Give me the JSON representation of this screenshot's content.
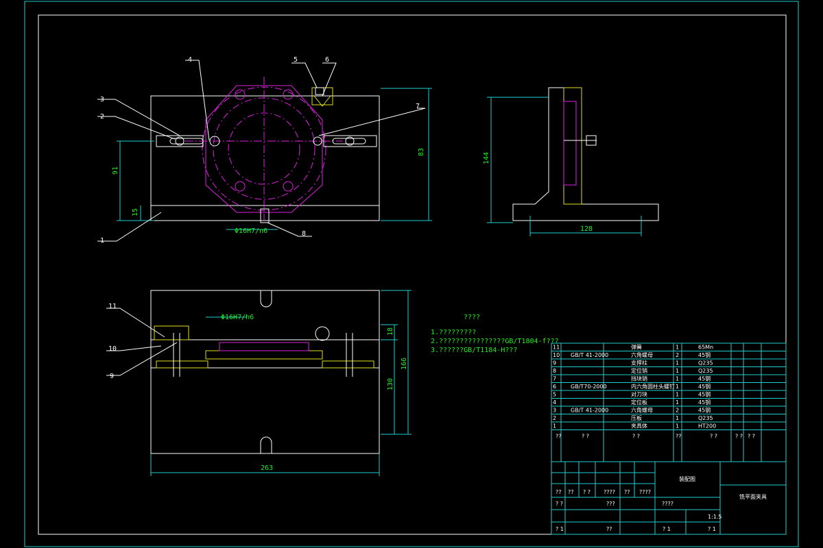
{
  "colors": {
    "background": "#000000",
    "frame": "#20d0d0",
    "outline": "#ffffff",
    "magenta": "#e020e0",
    "dim": "#20d0d0",
    "note": "#20e020",
    "hatch": "#e0e020"
  },
  "balloons": [
    "1",
    "2",
    "3",
    "4",
    "5",
    "6",
    "7",
    "8",
    "9",
    "10",
    "11"
  ],
  "dims": {
    "front_height": "83",
    "front_center": "91",
    "front_base": "15",
    "front_bottom": "Φ16H7/n6",
    "side_height": "144",
    "side_width": "128",
    "top_width": "263",
    "top_height": "166",
    "top_inner": "130",
    "top_small": "18",
    "top_fit": "Φ16H7/h6"
  },
  "notes": {
    "title": "????",
    "lines": [
      "1.?????????",
      "2.????????????????GB/T1804-f???",
      "3.??????GB/T1184-H???"
    ]
  },
  "bom": [
    {
      "no": "11",
      "std": "",
      "name": "弹簧",
      "qty": "1",
      "mat": "65Mn"
    },
    {
      "no": "10",
      "std": "GB/T 41-2000",
      "name": "六角螺母",
      "qty": "2",
      "mat": "45钢"
    },
    {
      "no": "9",
      "std": "",
      "name": "支撑柱",
      "qty": "1",
      "mat": "Q235"
    },
    {
      "no": "8",
      "std": "",
      "name": "定位销",
      "qty": "1",
      "mat": "Q235"
    },
    {
      "no": "7",
      "std": "",
      "name": "挡块销",
      "qty": "1",
      "mat": "45钢"
    },
    {
      "no": "6",
      "std": "GB/T70-2000",
      "name": "内六角圆柱头螺钉",
      "qty": "1",
      "mat": "45钢"
    },
    {
      "no": "5",
      "std": "",
      "name": "对刀块",
      "qty": "1",
      "mat": "45钢"
    },
    {
      "no": "4",
      "std": "",
      "name": "定位板",
      "qty": "1",
      "mat": "45钢"
    },
    {
      "no": "3",
      "std": "GB/T 41-2000",
      "name": "六角螺母",
      "qty": "2",
      "mat": "45钢"
    },
    {
      "no": "2",
      "std": "",
      "name": "压板",
      "qty": "1",
      "mat": "Q235"
    },
    {
      "no": "1",
      "std": "",
      "name": "夹具体",
      "qty": "1",
      "mat": "HT200"
    }
  ],
  "bom_header": [
    "??",
    "? ?",
    "? ?",
    "??",
    "? ?",
    "? ?",
    "? ?"
  ],
  "title_block": {
    "drawing_type": "装配图",
    "part_name": "铣平面夹具",
    "row1": [
      "??",
      "??",
      "? ?",
      "????",
      "??",
      "????"
    ],
    "row2": [
      "? ?",
      "???"
    ],
    "row3": [
      "????"
    ],
    "scale": "1:1.5",
    "row4": [
      "? 1",
      "? 1"
    ],
    "row5": [
      "? 1",
      "??"
    ]
  }
}
